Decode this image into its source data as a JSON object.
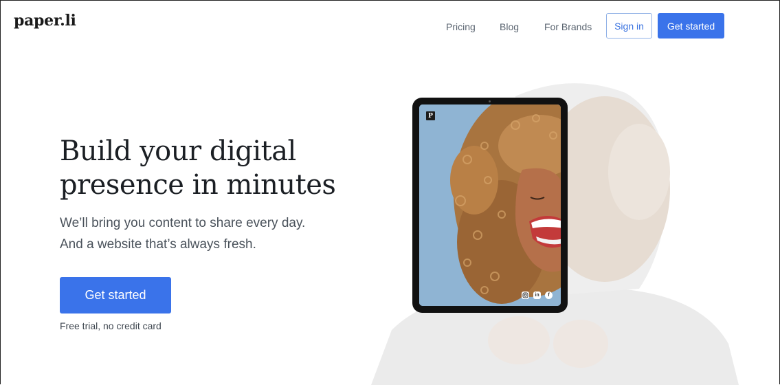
{
  "header": {
    "logo": "paper.li",
    "nav": [
      "Pricing",
      "Blog",
      "For Brands"
    ],
    "sign_in": "Sign in",
    "get_started": "Get started"
  },
  "hero": {
    "title_line1": "Build your digital",
    "title_line2": "presence in minutes",
    "subtitle_line1": "We’ll bring you content to share every day.",
    "subtitle_line2": "And a website that’s always fresh.",
    "cta": "Get started",
    "note": "Free trial, no credit card"
  },
  "tablet": {
    "badge": "P",
    "social_icons": [
      "instagram-icon",
      "linkedin-icon",
      "facebook-icon"
    ],
    "linkedin_glyph": "in",
    "facebook_glyph": "f"
  },
  "colors": {
    "accent": "#3a73ea",
    "sky": "#8fb4d3",
    "hair": "#b07a45"
  }
}
